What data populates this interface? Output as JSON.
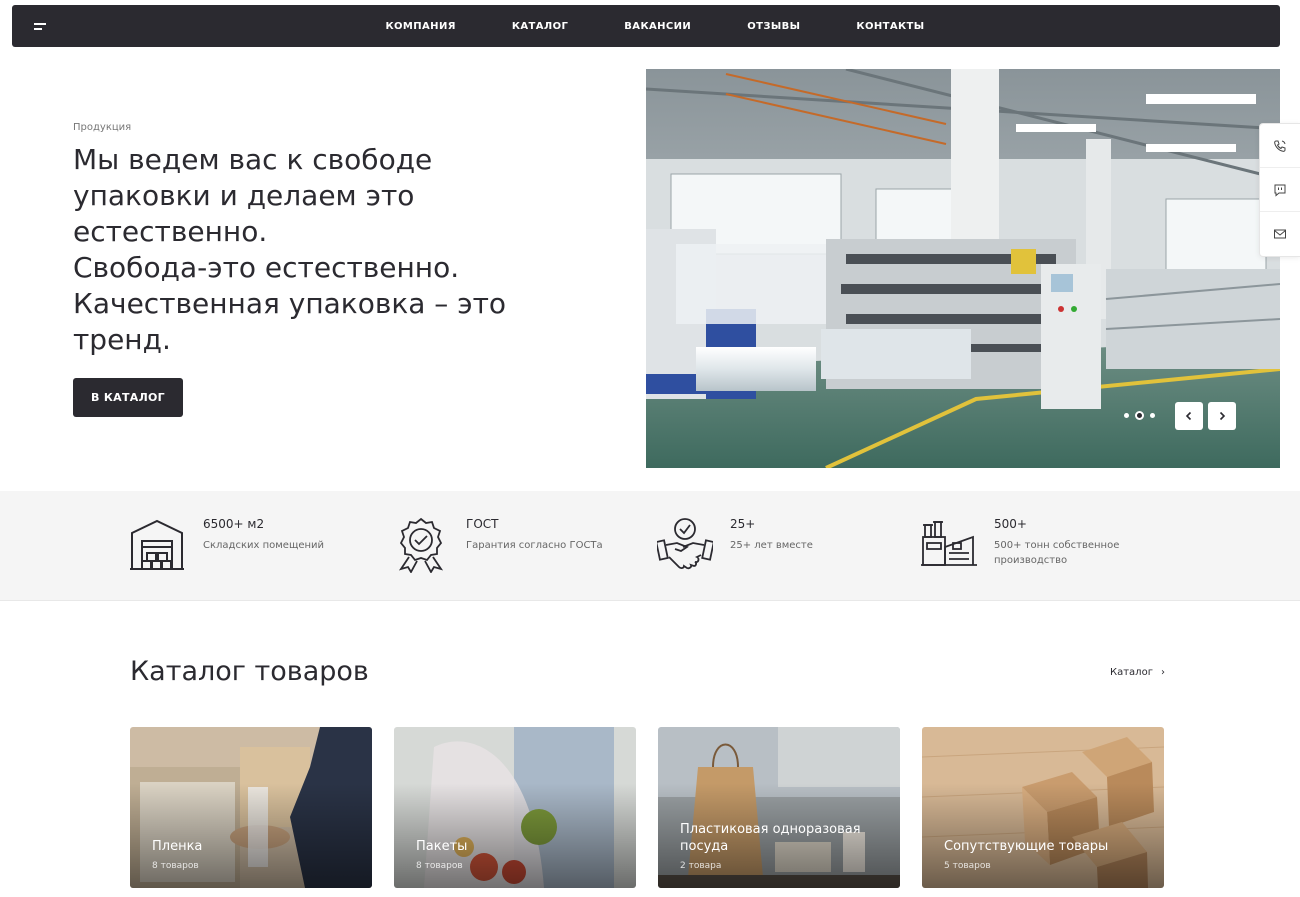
{
  "nav": {
    "items": [
      "КОМПАНИЯ",
      "КАТАЛОГ",
      "ВАКАНСИИ",
      "ОТЗЫВЫ",
      "КОНТАКТЫ"
    ]
  },
  "hero": {
    "subtitle": "Продукция",
    "title_lines": [
      "Мы ведем вас к свободе",
      "упаковки и делаем это",
      "естественно.",
      "Свобода-это естественно.",
      "Качественная упаковка – это",
      "тренд."
    ],
    "cta_label": "В КАТАЛОГ",
    "slider": {
      "slides": 3,
      "active": 2
    }
  },
  "side_widget": [
    "phone-icon",
    "chat-icon",
    "mail-icon"
  ],
  "features": [
    {
      "icon": "warehouse-icon",
      "title": "6500+ м2",
      "text": "Складских помещений"
    },
    {
      "icon": "gost-badge-icon",
      "title": "ГОСТ",
      "text": "Гарантия согласно ГОСТа"
    },
    {
      "icon": "handshake-icon",
      "title": "25+",
      "text": "25+ лет вместе"
    },
    {
      "icon": "factory-icon",
      "title": "500+",
      "text": "500+ тонн собственное производство"
    }
  ],
  "catalog": {
    "title": "Каталог товаров",
    "link_label": "Каталог",
    "cards": [
      {
        "name": "Пленка",
        "count": "8 товаров"
      },
      {
        "name": "Пакеты",
        "count": "8 товаров"
      },
      {
        "name": "Пластиковая одноразовая посуда",
        "count": "2 товара"
      },
      {
        "name": "Сопутствующие товары",
        "count": "5 товаров"
      }
    ]
  },
  "colors": {
    "dark": "#2b2a30",
    "band": "#f5f5f5",
    "text_muted": "#666666"
  }
}
